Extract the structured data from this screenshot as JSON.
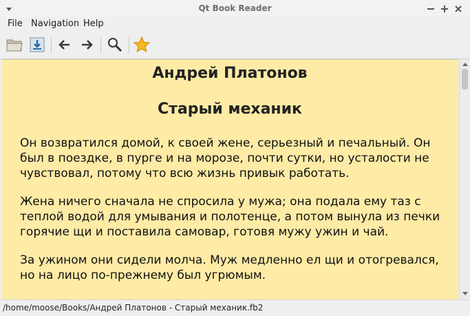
{
  "window": {
    "title": "Qt Book Reader"
  },
  "menu": {
    "file": "File",
    "navigation": "Navigation",
    "help": "Help"
  },
  "toolbar": {
    "icons": [
      "open-folder-icon",
      "download-icon",
      "back-arrow-icon",
      "forward-arrow-icon",
      "search-icon",
      "bookmark-star-icon"
    ]
  },
  "book": {
    "author": "Андрей Платонов",
    "title": "Старый механик",
    "paragraphs": [
      "Он возвратился домой, к своей жене, серьезный и печальный. Он был в поездке, в пурге и на морозе, почти сутки, но усталости не чувствовал, потому что всю жизнь привык работать.",
      "Жена ничего сначала не спросила у мужа; она подала ему таз с теплой водой для умывания и полотенце, а потом вынула из печки горячие щи и поставила самовар, готовя мужу ужин и чай.",
      "За ужином они сидели молча. Муж медленно ел щи и отогревался, но на лицо по-прежнему был угрюмым."
    ]
  },
  "status": {
    "path": "/home/moose/Books/Андрей Платонов - Старый механик.fb2"
  },
  "colors": {
    "page_background": "#feeba6",
    "text": "#111111"
  }
}
